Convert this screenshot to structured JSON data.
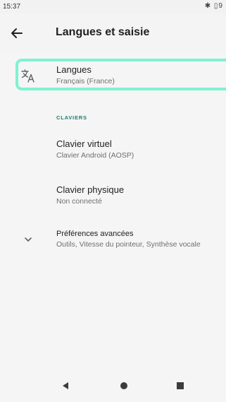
{
  "status_bar": {
    "time": "15:37",
    "icons": "✱ ▯9"
  },
  "app_bar": {
    "title": "Langues et saisie"
  },
  "settings": {
    "languages": {
      "title": "Langues",
      "subtitle": "Français (France)"
    },
    "section_header": "CLAVIERS",
    "virtual_keyboard": {
      "title": "Clavier virtuel",
      "subtitle": "Clavier Android (AOSP)"
    },
    "physical_keyboard": {
      "title": "Clavier physique",
      "subtitle": "Non connecté"
    },
    "advanced": {
      "title": "Préférences avancées",
      "subtitle": "Outils, Vitesse du pointeur, Synthèse vocale"
    }
  },
  "colors": {
    "highlight": "#7ff2d1",
    "section_header": "#1a7f72"
  },
  "icons": [
    "back-arrow-icon",
    "translate-icon",
    "chevron-down-icon",
    "nav-back-icon",
    "nav-home-icon",
    "nav-recents-icon"
  ]
}
